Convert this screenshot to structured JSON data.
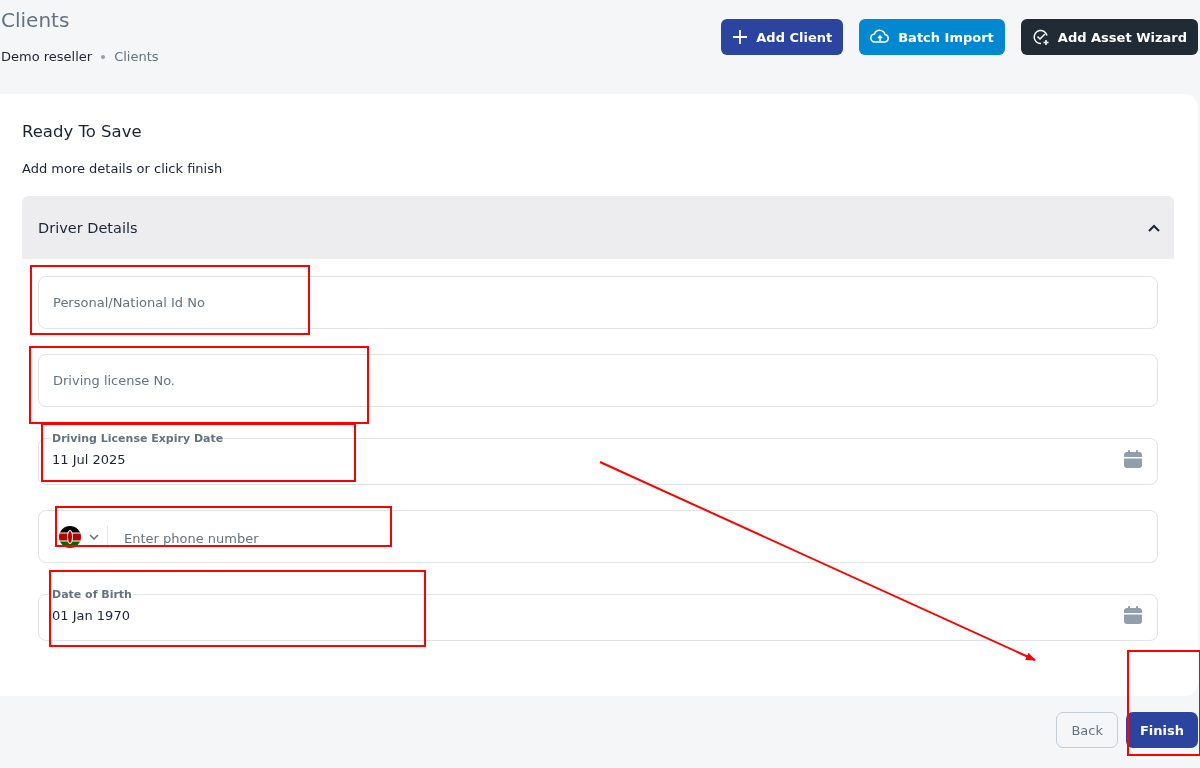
{
  "page": {
    "title": "Clients"
  },
  "breadcrumb": [
    {
      "label": "Demo reseller",
      "current": false
    },
    {
      "label": "Clients",
      "current": true
    }
  ],
  "actions": [
    {
      "label": "Add Client",
      "kind": "add"
    },
    {
      "label": "Batch Import",
      "kind": "import"
    },
    {
      "label": "Add Asset Wizard",
      "kind": "wizard"
    }
  ],
  "card": {
    "title": "Ready To Save",
    "subtitle": "Add more details or click finish",
    "section": {
      "title": "Driver Details",
      "expanded": true,
      "fields": [
        {
          "kind": "text",
          "placeholder": "Personal/National Id No"
        },
        {
          "kind": "text",
          "placeholder": "Driving license No."
        },
        {
          "kind": "date",
          "label": "Driving License Expiry Date",
          "value": "11 Jul 2025"
        },
        {
          "kind": "phone",
          "placeholder": "Enter phone number"
        },
        {
          "kind": "date",
          "label": "Date of Birth",
          "value": "01 Jan 1970"
        }
      ]
    }
  },
  "footer_buttons": [
    {
      "label": "Back",
      "kind": "secondary"
    },
    {
      "label": "Finish",
      "kind": "primary"
    }
  ]
}
